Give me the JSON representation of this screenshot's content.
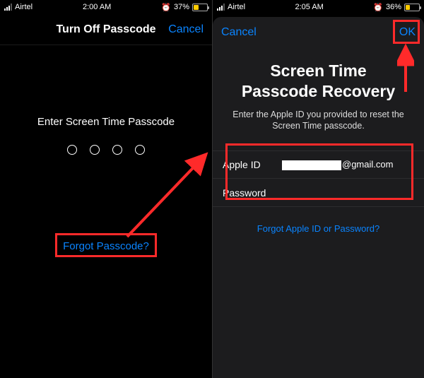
{
  "left": {
    "status": {
      "carrier": "Airtel",
      "time": "2:00 AM",
      "battery_pct": "37%"
    },
    "nav": {
      "title": "Turn Off Passcode",
      "cancel": "Cancel"
    },
    "prompt": "Enter Screen Time Passcode",
    "forgot": "Forgot Passcode?"
  },
  "right": {
    "status": {
      "carrier": "Airtel",
      "time": "2:05 AM",
      "battery_pct": "36%"
    },
    "modal": {
      "cancel": "Cancel",
      "ok": "OK",
      "title_line1": "Screen Time",
      "title_line2": "Passcode Recovery",
      "subtitle": "Enter the Apple ID you provided to reset the Screen Time passcode.",
      "apple_id_label": "Apple ID",
      "apple_id_value_suffix": "@gmail.com",
      "password_label": "Password",
      "forgot": "Forgot Apple ID or Password?"
    }
  }
}
